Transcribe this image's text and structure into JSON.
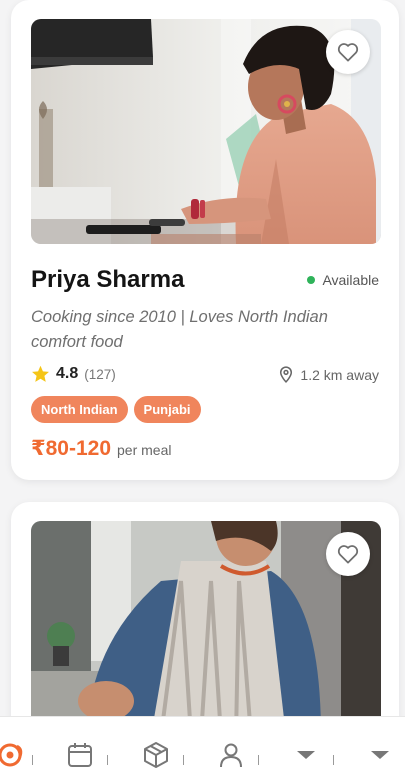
{
  "cards": [
    {
      "name": "Priya Sharma",
      "status": "Available",
      "bio": "Cooking since 2010 | Loves North Indian comfort food",
      "rating": "4.8",
      "reviews": "(127)",
      "distance": "1.2 km away",
      "tags": [
        "North Indian",
        "Punjabi"
      ],
      "price": "₹80-120",
      "price_unit": "per meal"
    }
  ],
  "icons": {
    "favorite": "heart-outline-icon",
    "star": "star-icon",
    "location": "location-pin-icon"
  },
  "tabbar": {
    "items": [
      "home-logo-icon",
      "calendar-icon",
      "package-icon",
      "profile-icon",
      "chevron-down-icon",
      "chevron-down-icon"
    ]
  },
  "colors": {
    "accent": "#f06a31",
    "tag": "#f0855c",
    "available": "#2fb35a",
    "star": "#f5c518"
  }
}
